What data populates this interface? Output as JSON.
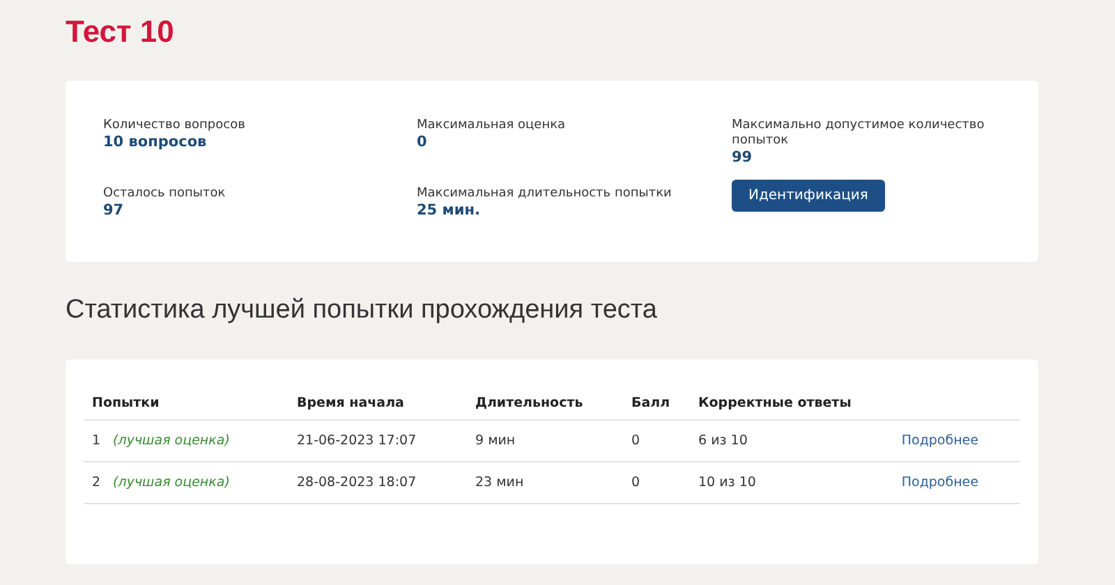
{
  "title": "Тест 10",
  "info": [
    {
      "label": "Количество вопросов",
      "value": "10 вопросов"
    },
    {
      "label": "Максимальная оценка",
      "value": "0"
    },
    {
      "label": "Максимально допустимое количество попыток",
      "value": "99"
    },
    {
      "label": "Осталось попыток",
      "value": "97"
    },
    {
      "label": "Максимальная длительность попытки",
      "value": "25 мин."
    }
  ],
  "identify_button": "Идентификация",
  "stats_heading": "Статистика лучшей попытки прохождения теста",
  "table": {
    "columns": [
      "Попытки",
      "Время начала",
      "Длительность",
      "Балл",
      "Корректные ответы"
    ],
    "rows": [
      {
        "number": "1",
        "note": "(лучшая оценка)",
        "start": "21-06-2023 17:07",
        "duration": "9 мин",
        "score": "0",
        "correct": "6 из 10",
        "link": "Подробнее"
      },
      {
        "number": "2",
        "note": "(лучшая оценка)",
        "start": "28-08-2023 18:07",
        "duration": "23 мин",
        "score": "0",
        "correct": "10 из 10",
        "link": "Подробнее"
      }
    ]
  }
}
